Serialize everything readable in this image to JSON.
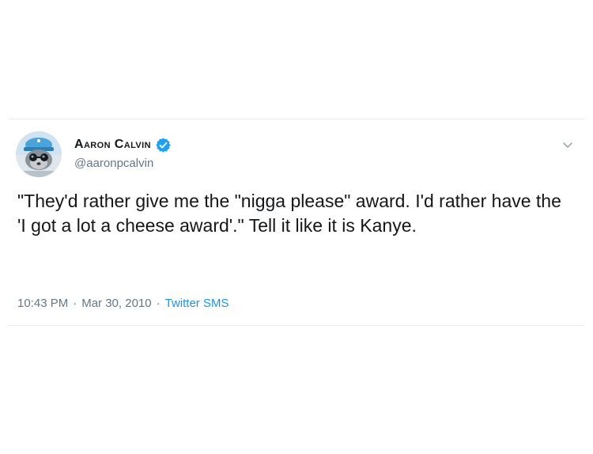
{
  "tweet": {
    "author": {
      "display_name": "Aaron Calvin",
      "handle": "@aaronpcalvin",
      "verified": true
    },
    "text": "\"They'd rather give me the \"nigga please\" award. I'd rather have the 'I got a lot a cheese award'.\" Tell it like it is Kanye.",
    "time": "10:43 PM",
    "separator": "·",
    "date": "Mar 30, 2010",
    "source": "Twitter SMS"
  },
  "colors": {
    "verified_badge": "#1da1f2",
    "link": "#1b95e0",
    "secondary_text": "#657786",
    "primary_text": "#14171a"
  },
  "icons": {
    "verified": "verified-badge-icon",
    "menu": "chevron-down-icon",
    "avatar": "cartoon-hedgehog-avatar"
  }
}
